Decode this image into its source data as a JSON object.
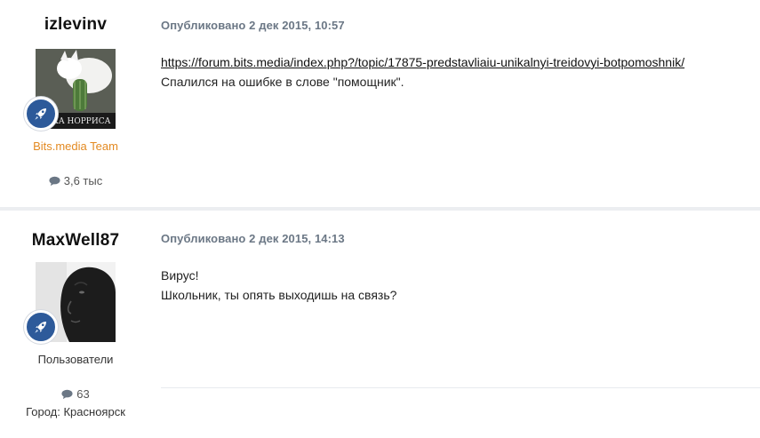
{
  "posts": [
    {
      "author": "izlevinv",
      "group": "Bits.media Team",
      "post_count": "3,6 тыс",
      "date": "Опубликовано 2 дек 2015, 10:57",
      "avatar_caption": "ЯКА НОРРИСА",
      "link": "https://forum.bits.media/index.php?/topic/17875-predstavliaiu-unikalnyi-treidovyi-botpomoshnik/",
      "text": "Спалился на ошибке в слове \"помощник\"."
    },
    {
      "author": "MaxWell87",
      "group": "Пользователи",
      "post_count": "63",
      "city": "Город: Красноярск",
      "date": "Опубликовано 2 дек 2015, 14:13",
      "lines": [
        "Вирус!",
        "Школьник, ты опять выходишь на связь?"
      ]
    }
  ],
  "colors": {
    "team_group": "#e38a22",
    "badge": "#2d5a9a",
    "meta": "#6b7785"
  },
  "icons": {
    "rank": "rocket-icon",
    "posts": "comment-icon"
  }
}
